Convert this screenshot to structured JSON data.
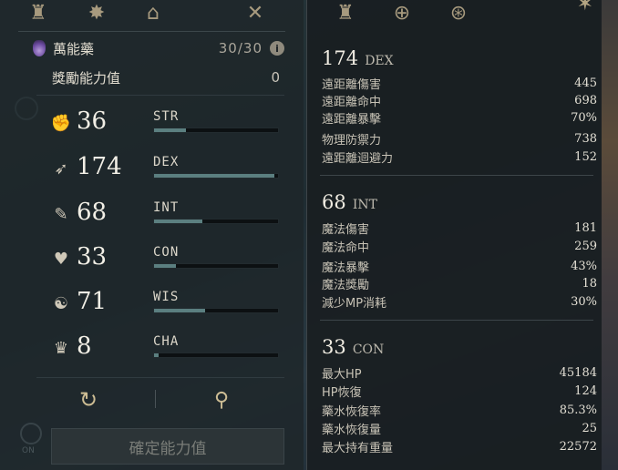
{
  "left_tabs": [
    {
      "icon": "helmet-icon",
      "glyph": "♜"
    },
    {
      "icon": "compass-star-icon",
      "glyph": "✸"
    },
    {
      "icon": "temple-icon",
      "glyph": "⌂"
    },
    {
      "icon": "crossed-swords-icon",
      "glyph": "✕"
    }
  ],
  "potion": {
    "name": "萬能藥",
    "count": "30/30",
    "info_icon_text": "i"
  },
  "bonus": {
    "label": "獎勵能力值",
    "value": "0"
  },
  "stats": [
    {
      "icon": "strength-arm-icon",
      "glyph": "✊",
      "value": "36",
      "name": "STR",
      "fill": 0.26
    },
    {
      "icon": "dexterity-boot-icon",
      "glyph": "➶",
      "value": "174",
      "name": "DEX",
      "fill": 0.97
    },
    {
      "icon": "intelligence-book-icon",
      "glyph": "✎",
      "value": "68",
      "name": "INT",
      "fill": 0.39
    },
    {
      "icon": "constitution-heart-icon",
      "glyph": "♥",
      "value": "33",
      "name": "CON",
      "fill": 0.18
    },
    {
      "icon": "wisdom-head-icon",
      "glyph": "☯",
      "value": "71",
      "name": "WIS",
      "fill": 0.41
    },
    {
      "icon": "charisma-crown-icon",
      "glyph": "♛",
      "value": "8",
      "name": "CHA",
      "fill": 0.04
    }
  ],
  "buttons": {
    "reset_glyph": "↻",
    "search_glyph": "⚲",
    "on_label": "ON",
    "confirm_label": "確定能力值"
  },
  "right_tabs": [
    {
      "icon": "helmet-icon",
      "glyph": "♜"
    },
    {
      "icon": "helmet-plus-icon",
      "glyph": "⊕"
    },
    {
      "icon": "helmet-settings-icon",
      "glyph": "⊛"
    }
  ],
  "right_close_glyph": "✶",
  "sections": [
    {
      "value": "174",
      "abbr": "DEX",
      "rows": [
        {
          "label": "遠距離傷害",
          "value": "445"
        },
        {
          "label": "遠距離命中",
          "value": "698"
        },
        {
          "label": "遠距離暴擊",
          "value": "70%"
        },
        {
          "label": "物理防禦力",
          "value": "738"
        },
        {
          "label": "遠距離迴避力",
          "value": "152"
        }
      ]
    },
    {
      "value": "68",
      "abbr": "INT",
      "rows": [
        {
          "label": "魔法傷害",
          "value": "181"
        },
        {
          "label": "魔法命中",
          "value": "259"
        },
        {
          "label": "魔法暴擊",
          "value": "43%"
        },
        {
          "label": "魔法獎勵",
          "value": "18"
        },
        {
          "label": "減少MP消耗",
          "value": "30%"
        }
      ]
    },
    {
      "value": "33",
      "abbr": "CON",
      "rows": [
        {
          "label": "最大HP",
          "value": "45184"
        },
        {
          "label": "HP恢復",
          "value": "124"
        },
        {
          "label": "藥水恢復率",
          "value": "85.3%"
        },
        {
          "label": "藥水恢復量",
          "value": "25"
        },
        {
          "label": "最大持有重量",
          "value": "22572"
        }
      ]
    }
  ]
}
